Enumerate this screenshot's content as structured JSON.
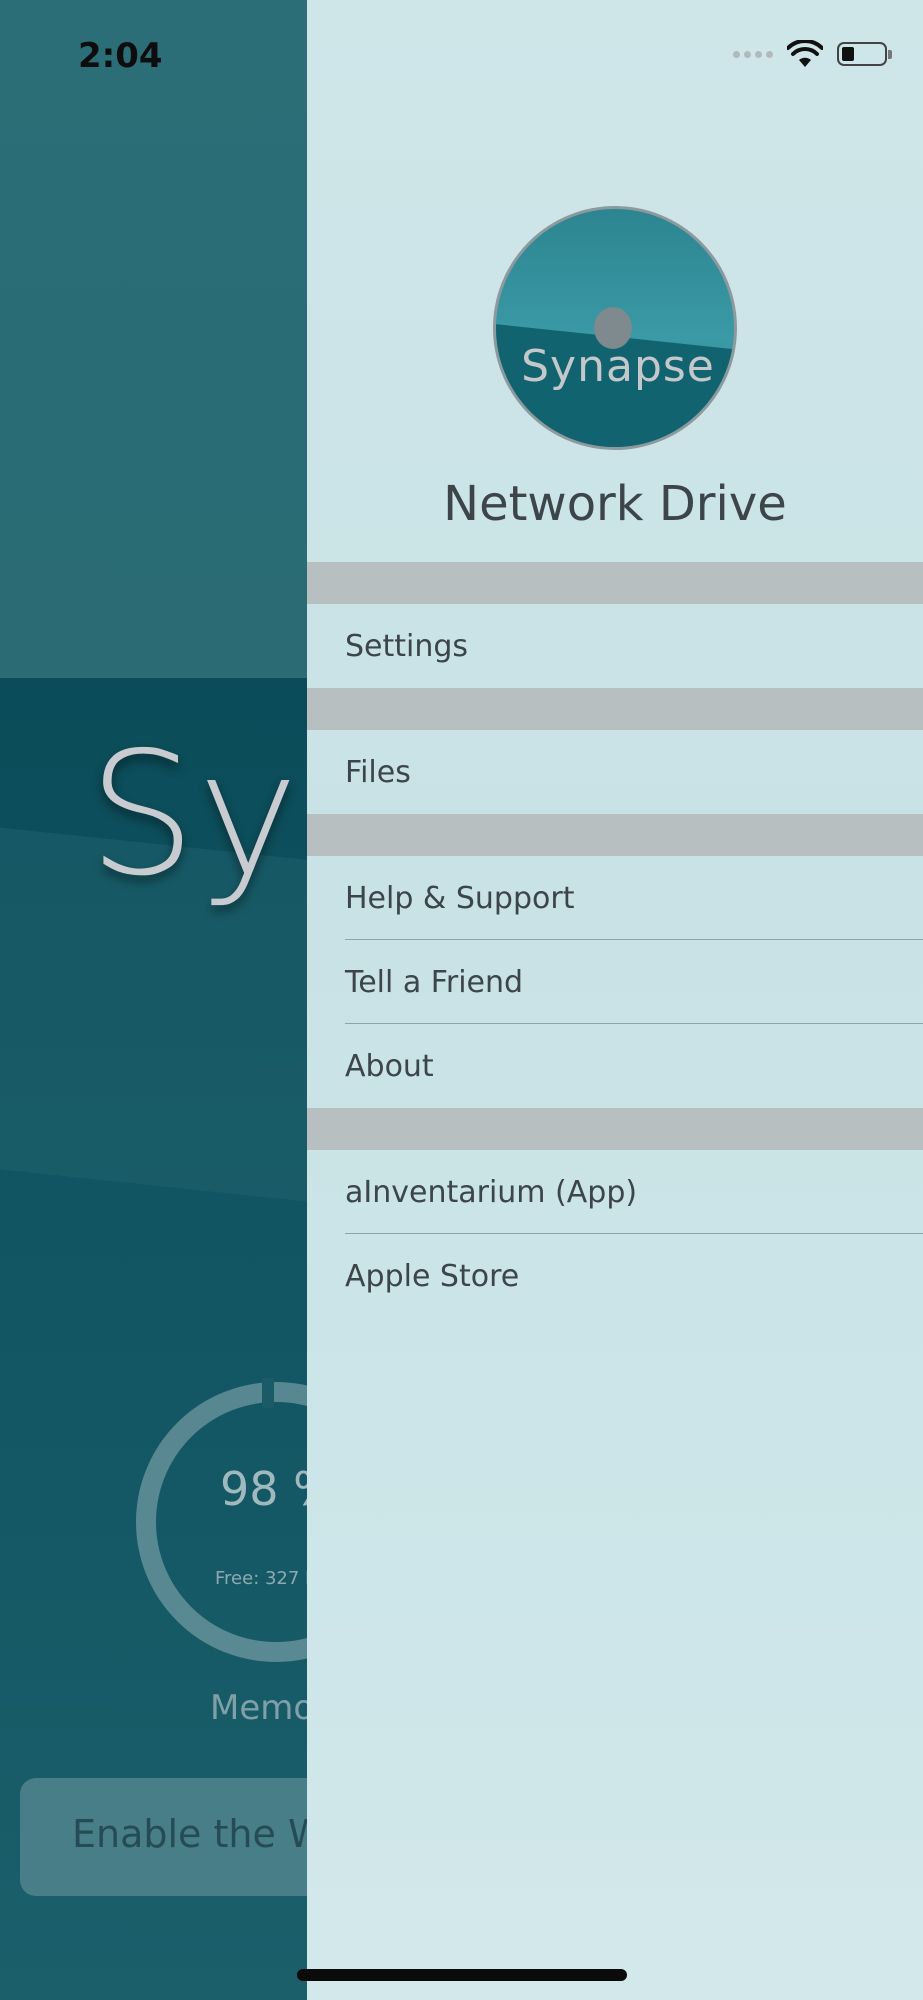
{
  "status_bar": {
    "time": "2:04"
  },
  "background_app": {
    "logo_text": "Sy",
    "memory_percent": "98 %",
    "memory_free": "Free: 327 I",
    "memory_label": "Memo",
    "enable_banner": "Enable the W"
  },
  "drawer": {
    "avatar_text": "Synapse",
    "title": "Network Drive",
    "sections": [
      {
        "items": [
          "Settings"
        ]
      },
      {
        "items": [
          "Files"
        ]
      },
      {
        "items": [
          "Help & Support",
          "Tell a Friend",
          "About"
        ]
      },
      {
        "items": [
          "aInventarium (App)",
          "Apple Store"
        ]
      }
    ]
  },
  "colors": {
    "drawer_bg": "#cfe6e9",
    "separator": "#b7bfc0",
    "text": "#3c454a"
  },
  "icons": [
    "wifi-icon",
    "battery-icon",
    "cellular-signal-icon"
  ]
}
